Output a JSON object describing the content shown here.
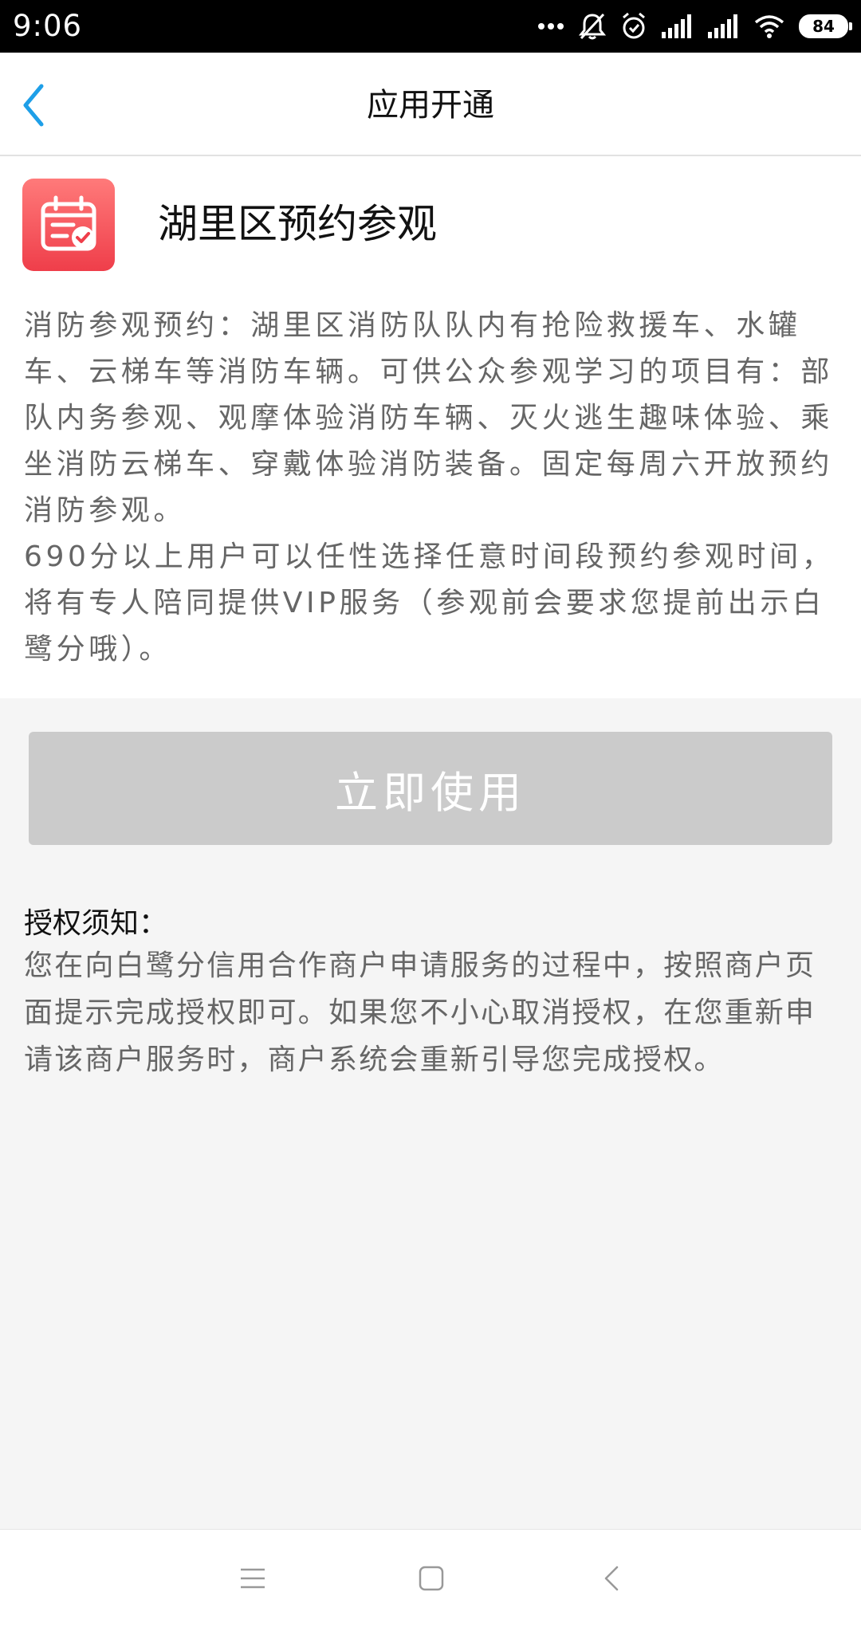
{
  "status_bar": {
    "time": "9:06",
    "battery": "84",
    "icons": [
      "more-dots-icon",
      "mute-icon",
      "alarm-icon",
      "signal-icon",
      "signal-icon",
      "wifi-icon",
      "battery-icon"
    ]
  },
  "nav": {
    "title": "应用开通",
    "back_icon": "chevron-left-icon",
    "accent_color": "#1e9fe8"
  },
  "app": {
    "icon": "calendar-check-icon",
    "icon_color": "#ef3e4a",
    "name": "湖里区预约参观",
    "description_p1": "消防参观预约：湖里区消防队队内有抢险救援车、水罐车、云梯车等消防车辆。可供公众参观学习的项目有：部队内务参观、观摩体验消防车辆、灭火逃生趣味体验、乘坐消防云梯车、穿戴体验消防装备。固定每周六开放预约消防参观。",
    "description_p2": "690分以上用户可以任性选择任意时间段预约参观时间，将有专人陪同提供VIP服务（参观前会要求您提前出示白鹭分哦）。"
  },
  "action": {
    "use_button_label": "立即使用",
    "button_color": "#cbcbcb"
  },
  "notice": {
    "title": "授权须知：",
    "body": "您在向白鹭分信用合作商户申请服务的过程中，按照商户页面提示完成授权即可。如果您不小心取消授权，在您重新申请该商户服务时，商户系统会重新引导您完成授权。"
  },
  "system_nav": {
    "icons": [
      "menu-icon",
      "home-square-icon",
      "back-chevron-icon"
    ]
  }
}
